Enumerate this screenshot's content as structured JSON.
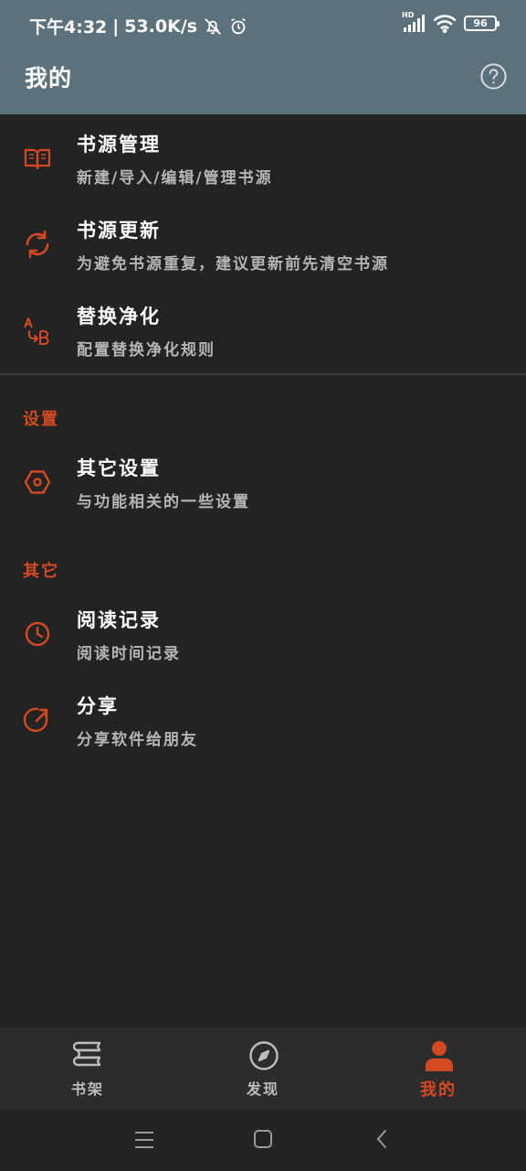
{
  "status_bar": {
    "time": "下午4:32",
    "separator": "|",
    "network_speed": "53.0K/s",
    "hd_label": "HD",
    "battery": "96"
  },
  "app_bar": {
    "title": "我的",
    "help_icon": "question-circle-icon"
  },
  "menu_top": [
    {
      "title": "书源管理",
      "subtitle": "新建/导入/编辑/管理书源",
      "icon": "book-open-icon"
    },
    {
      "title": "书源更新",
      "subtitle": "为避免书源重复，建议更新前先清空书源",
      "icon": "sync-icon"
    },
    {
      "title": "替换净化",
      "subtitle": "配置替换净化规则",
      "icon": "replace-ab-icon"
    }
  ],
  "settings_section": {
    "header": "设置",
    "items": [
      {
        "title": "其它设置",
        "subtitle": "与功能相关的一些设置",
        "icon": "hexagon-settings-icon"
      }
    ]
  },
  "other_section": {
    "header": "其它",
    "items": [
      {
        "title": "阅读记录",
        "subtitle": "阅读时间记录",
        "icon": "clock-icon"
      },
      {
        "title": "分享",
        "subtitle": "分享软件给朋友",
        "icon": "share-icon"
      }
    ]
  },
  "bottom_nav": [
    {
      "label": "书架",
      "icon": "bookshelf-icon",
      "active": false
    },
    {
      "label": "发现",
      "icon": "compass-icon",
      "active": false
    },
    {
      "label": "我的",
      "icon": "person-icon",
      "active": true
    }
  ],
  "colors": {
    "accent": "#d34a22",
    "header_bg": "#5b727c",
    "page_bg": "#232323",
    "nav_bg": "#2c2c2c"
  }
}
